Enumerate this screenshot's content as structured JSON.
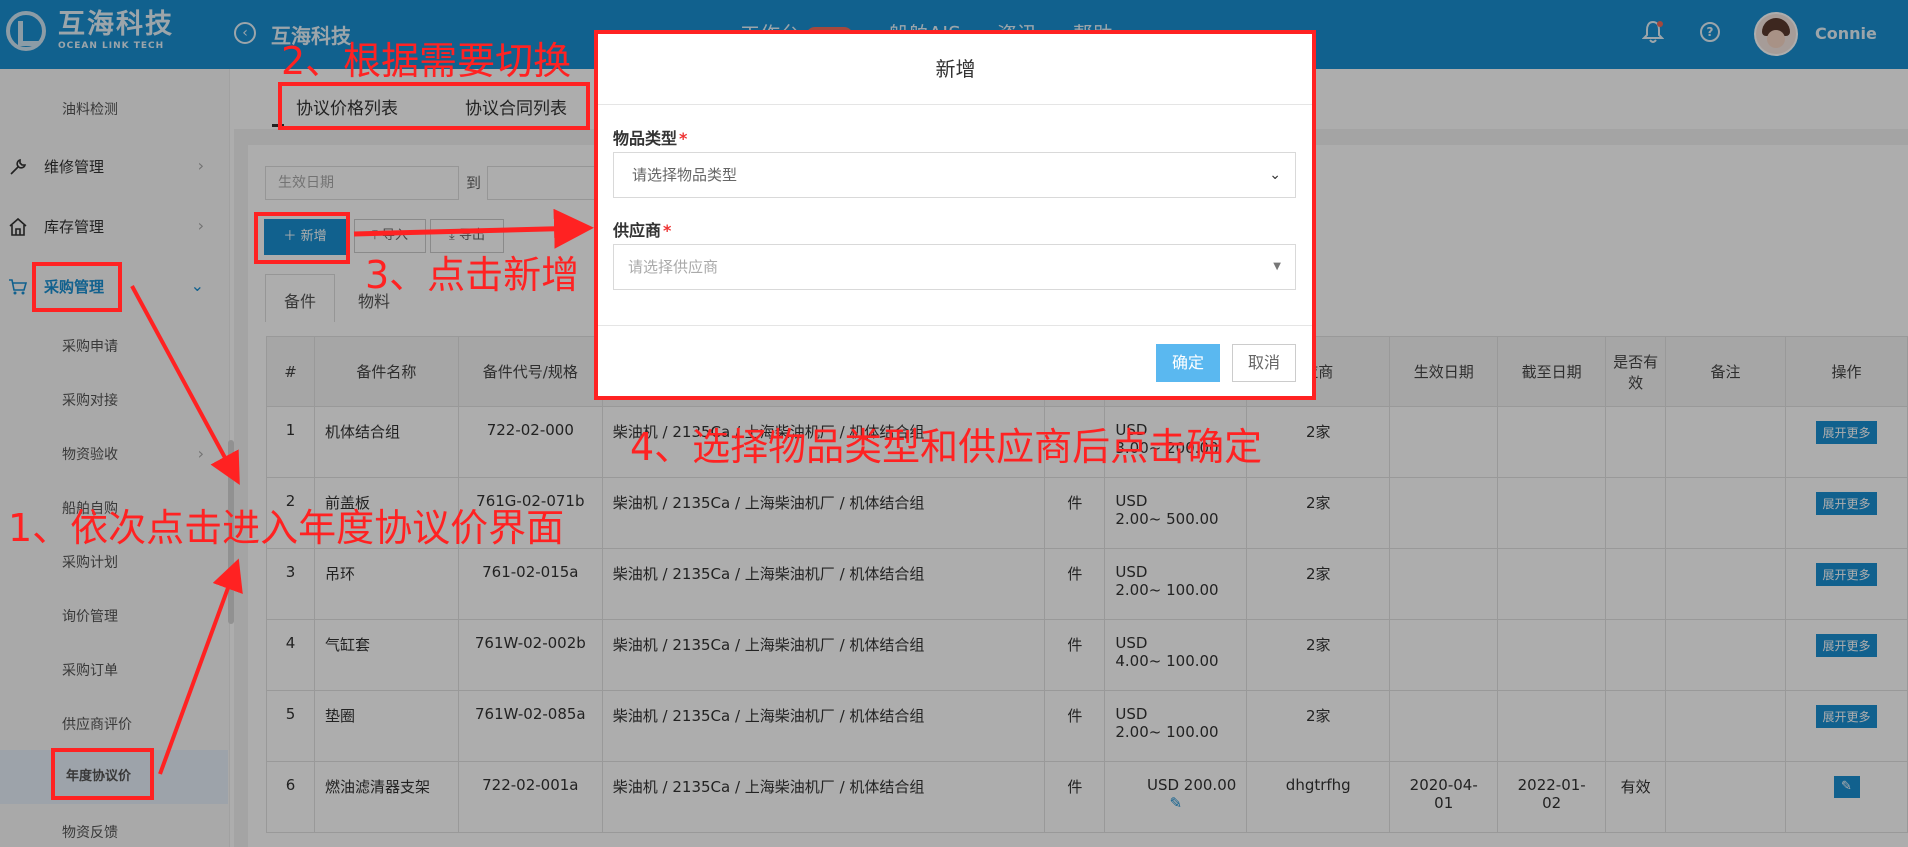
{
  "header": {
    "logo_cn": "互海科技",
    "logo_en": "OCEAN LINK TECH",
    "page_title": "互海科技",
    "nav": [
      {
        "label": "工作台",
        "badge": "9999"
      },
      {
        "label": "船舶AIS"
      },
      {
        "label": "资讯"
      },
      {
        "label": "帮助"
      }
    ],
    "username": "Connie"
  },
  "sidebar": {
    "items": [
      {
        "label": "油料检测",
        "level": "sub"
      },
      {
        "label": "维修管理",
        "level": "top"
      },
      {
        "label": "库存管理",
        "level": "top"
      },
      {
        "label": "采购管理",
        "level": "top",
        "expanded": true
      },
      {
        "label": "采购申请",
        "level": "sub"
      },
      {
        "label": "采购对接",
        "level": "sub"
      },
      {
        "label": "物资验收",
        "level": "sub"
      },
      {
        "label": "船舶自购",
        "level": "sub"
      },
      {
        "label": "采购计划",
        "level": "sub"
      },
      {
        "label": "询价管理",
        "level": "sub"
      },
      {
        "label": "采购订单",
        "level": "sub"
      },
      {
        "label": "供应商评价",
        "level": "sub"
      },
      {
        "label": "年度协议价",
        "level": "sub",
        "active": true
      },
      {
        "label": "物资反馈",
        "level": "sub"
      }
    ]
  },
  "tabs": {
    "price_list": "协议价格列表",
    "contract_list": "协议合同列表"
  },
  "filters": {
    "date_placeholder": "生效日期",
    "to": "到"
  },
  "toolbar": {
    "add": "新增",
    "import": "导入",
    "export": "导出"
  },
  "subtabs": {
    "parts": "备件",
    "materials": "物料"
  },
  "table": {
    "headers": [
      "#",
      "备件名称",
      "备件代号/规格",
      "",
      "",
      "",
      "应商",
      "生效日期",
      "截至日期",
      "是否有效",
      "备注",
      "操作"
    ],
    "more_label": "展开更多",
    "rows": [
      {
        "no": "1",
        "name": "机体结合组",
        "code": "722-02-000",
        "device": "柴油机 / 2135Ca / 上海柴油机厂 / 机体结合组",
        "unit": "",
        "price_line1": "USD",
        "price_line2": "3.00~ 200.00",
        "supplier": "2家",
        "start": "",
        "end": "",
        "valid": ""
      },
      {
        "no": "2",
        "name": "前盖板",
        "code": "761G-02-071b",
        "device": "柴油机 / 2135Ca / 上海柴油机厂 / 机体结合组",
        "unit": "件",
        "price_line1": "USD",
        "price_line2": "2.00~ 500.00",
        "supplier": "2家",
        "start": "",
        "end": "",
        "valid": ""
      },
      {
        "no": "3",
        "name": "吊环",
        "code": "761-02-015a",
        "device": "柴油机 / 2135Ca / 上海柴油机厂 / 机体结合组",
        "unit": "件",
        "price_line1": "USD",
        "price_line2": "2.00~ 100.00",
        "supplier": "2家",
        "start": "",
        "end": "",
        "valid": ""
      },
      {
        "no": "4",
        "name": "气缸套",
        "code": "761W-02-002b",
        "device": "柴油机 / 2135Ca / 上海柴油机厂 / 机体结合组",
        "unit": "件",
        "price_line1": "USD",
        "price_line2": "4.00~ 100.00",
        "supplier": "2家",
        "start": "",
        "end": "",
        "valid": ""
      },
      {
        "no": "5",
        "name": "垫圈",
        "code": "761W-02-085a",
        "device": "柴油机 / 2135Ca / 上海柴油机厂 / 机体结合组",
        "unit": "件",
        "price_line1": "USD",
        "price_line2": "2.00~ 100.00",
        "supplier": "2家",
        "start": "",
        "end": "",
        "valid": ""
      },
      {
        "no": "6",
        "name": "燃油滤清器支架",
        "code": "722-02-001a",
        "device": "柴油机 / 2135Ca / 上海柴油机厂 / 机体结合组",
        "unit": "件",
        "price_line1": "USD  200.00",
        "price_line2": "",
        "supplier": "dhgtrfhg",
        "start": "2020-04-01",
        "end": "2022-01-02",
        "valid": "有效"
      }
    ]
  },
  "modal": {
    "title": "新增",
    "type_label": "物品类型",
    "type_value": "请选择物品类型",
    "supplier_label": "供应商",
    "supplier_placeholder": "请选择供应商",
    "ok": "确定",
    "cancel": "取消"
  },
  "annotations": {
    "step1": "1、依次点击进入年度协议价界面",
    "step2": "2、根据需要切换",
    "step3": "3、点击新增",
    "step4": "4、选择物品类型和供应商后点击确定"
  },
  "colors": {
    "brand": "#1a8fd2",
    "annotation": "#ff2222",
    "confirm": "#5ab8f0"
  }
}
